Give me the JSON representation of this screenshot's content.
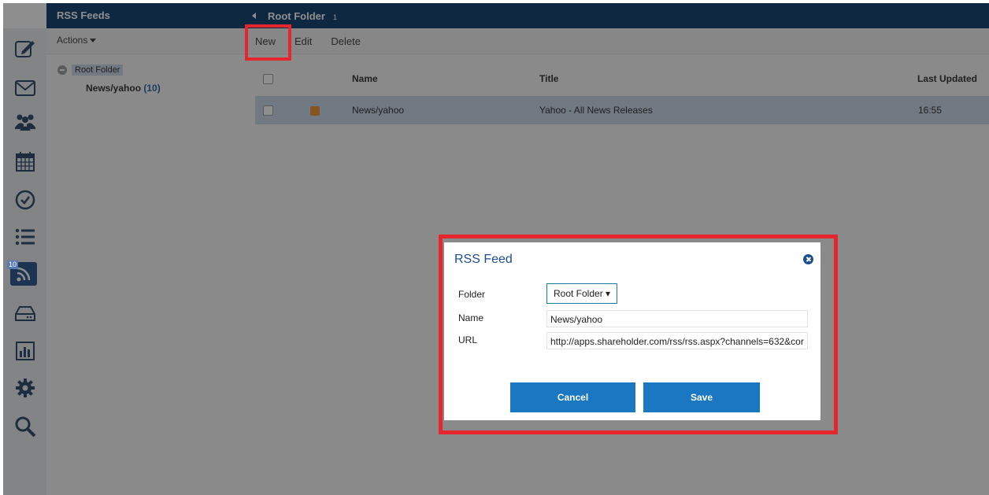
{
  "tree": {
    "header": "RSS Feeds",
    "actions_label": "Actions",
    "root": "Root Folder",
    "child_name": "News/yahoo",
    "child_count": "(10)"
  },
  "rail": {
    "icons": [
      "compose-icon",
      "mail-icon",
      "contacts-icon",
      "calendar-icon",
      "tasks-icon",
      "list-icon",
      "rss-icon",
      "drive-icon",
      "reports-icon",
      "settings-icon",
      "search-icon"
    ],
    "rss_badge": "10"
  },
  "main": {
    "header_title": "Root Folder",
    "header_count": "1",
    "toolbar": {
      "new": "New",
      "edit": "Edit",
      "delete": "Delete"
    },
    "columns": {
      "name": "Name",
      "title": "Title",
      "last_updated": "Last Updated"
    },
    "rows": [
      {
        "name": "News/yahoo",
        "title": "Yahoo - All News Releases",
        "last_updated": "16:55"
      }
    ]
  },
  "dialog": {
    "title": "RSS Feed",
    "folder_label": "Folder",
    "folder_value": "Root Folder ▾",
    "name_label": "Name",
    "name_value": "News/yahoo",
    "url_label": "URL",
    "url_value": "http://apps.shareholder.com/rss/rss.aspx?channels=632&cor",
    "cancel": "Cancel",
    "save": "Save"
  },
  "colors": {
    "header_bg": "#003366",
    "accent": "#1a78c2",
    "highlight": "#e5262f"
  }
}
